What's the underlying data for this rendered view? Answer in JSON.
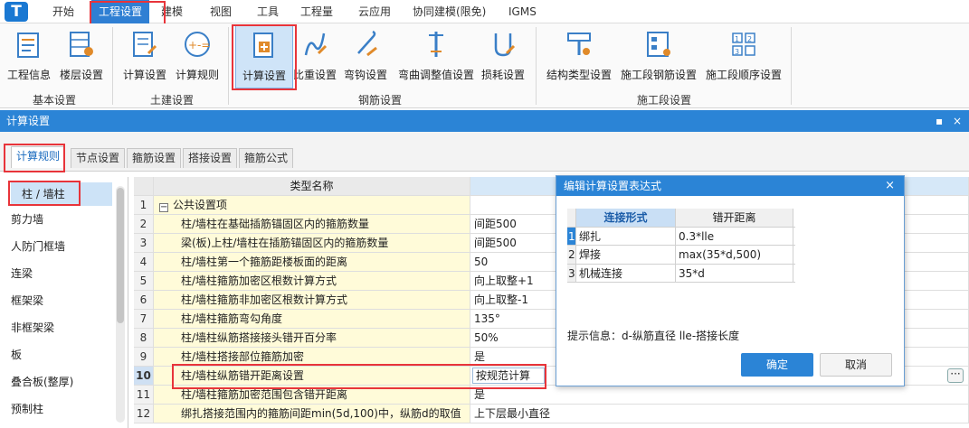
{
  "menu": {
    "items": [
      "开始",
      "工程设置",
      "建模",
      "视图",
      "工具",
      "工程量",
      "云应用",
      "协同建模(限免)",
      "IGMS"
    ],
    "active": "工程设置"
  },
  "ribbon": {
    "groups": [
      {
        "label": "基本设置",
        "buttons": [
          "工程信息",
          "楼层设置"
        ]
      },
      {
        "label": "土建设置",
        "buttons": [
          "计算设置",
          "计算规则"
        ]
      },
      {
        "label": "钢筋设置",
        "buttons": [
          "计算设置",
          "比重设置",
          "弯钩设置",
          "弯曲调整值设置",
          "损耗设置"
        ]
      },
      {
        "label": "施工段设置",
        "buttons": [
          "结构类型设置",
          "施工段钢筋设置",
          "施工段顺序设置"
        ]
      }
    ]
  },
  "panel": {
    "title": "计算设置",
    "pin": "▪",
    "close": "×"
  },
  "tabs": [
    "计算规则",
    "节点设置",
    "箍筋设置",
    "搭接设置",
    "箍筋公式"
  ],
  "left_list": [
    "柱 / 墙柱",
    "剪力墙",
    "人防门框墙",
    "连梁",
    "框架梁",
    "非框架梁",
    "板",
    "叠合板(整厚)",
    "预制柱"
  ],
  "grid": {
    "header": {
      "name": "类型名称"
    },
    "group_label": "公共设置项",
    "rows": [
      {
        "n": "1",
        "name": "公共设置项",
        "value": ""
      },
      {
        "n": "2",
        "name": "柱/墙柱在基础插筋锚固区内的箍筋数量",
        "value": "间距500"
      },
      {
        "n": "3",
        "name": "梁(板)上柱/墙柱在插筋锚固区内的箍筋数量",
        "value": "间距500"
      },
      {
        "n": "4",
        "name": "柱/墙柱第一个箍筋距楼板面的距离",
        "value": "50"
      },
      {
        "n": "5",
        "name": "柱/墙柱箍筋加密区根数计算方式",
        "value": "向上取整+1"
      },
      {
        "n": "6",
        "name": "柱/墙柱箍筋非加密区根数计算方式",
        "value": "向上取整-1"
      },
      {
        "n": "7",
        "name": "柱/墙柱箍筋弯勾角度",
        "value": "135°"
      },
      {
        "n": "8",
        "name": "柱/墙柱纵筋搭接接头错开百分率",
        "value": "50%"
      },
      {
        "n": "9",
        "name": "柱/墙柱搭接部位箍筋加密",
        "value": "是"
      },
      {
        "n": "10",
        "name": "柱/墙柱纵筋错开距离设置",
        "value": "按规范计算"
      },
      {
        "n": "11",
        "name": "柱/墙柱箍筋加密范围包含错开距离",
        "value": "是"
      },
      {
        "n": "12",
        "name": "绑扎搭接范围内的箍筋间距min(5d,100)中，纵筋d的取值",
        "value": "上下层最小直径"
      }
    ],
    "ellipsis": "···"
  },
  "dialog": {
    "title": "编辑计算设置表达式",
    "close": "×",
    "columns": [
      "连接形式",
      "错开距离"
    ],
    "rows": [
      {
        "n": "1",
        "type": "绑扎",
        "dist": "0.3*lle"
      },
      {
        "n": "2",
        "type": "焊接",
        "dist": "max(35*d,500)"
      },
      {
        "n": "3",
        "type": "机械连接",
        "dist": "35*d"
      }
    ],
    "hint": "提示信息：d-纵筋直径  lle-搭接长度",
    "ok": "确定",
    "cancel": "取消"
  },
  "colors": {
    "accent": "#2b84d6",
    "highlight": "#e8343a",
    "row_bg": "#fffbd9"
  }
}
